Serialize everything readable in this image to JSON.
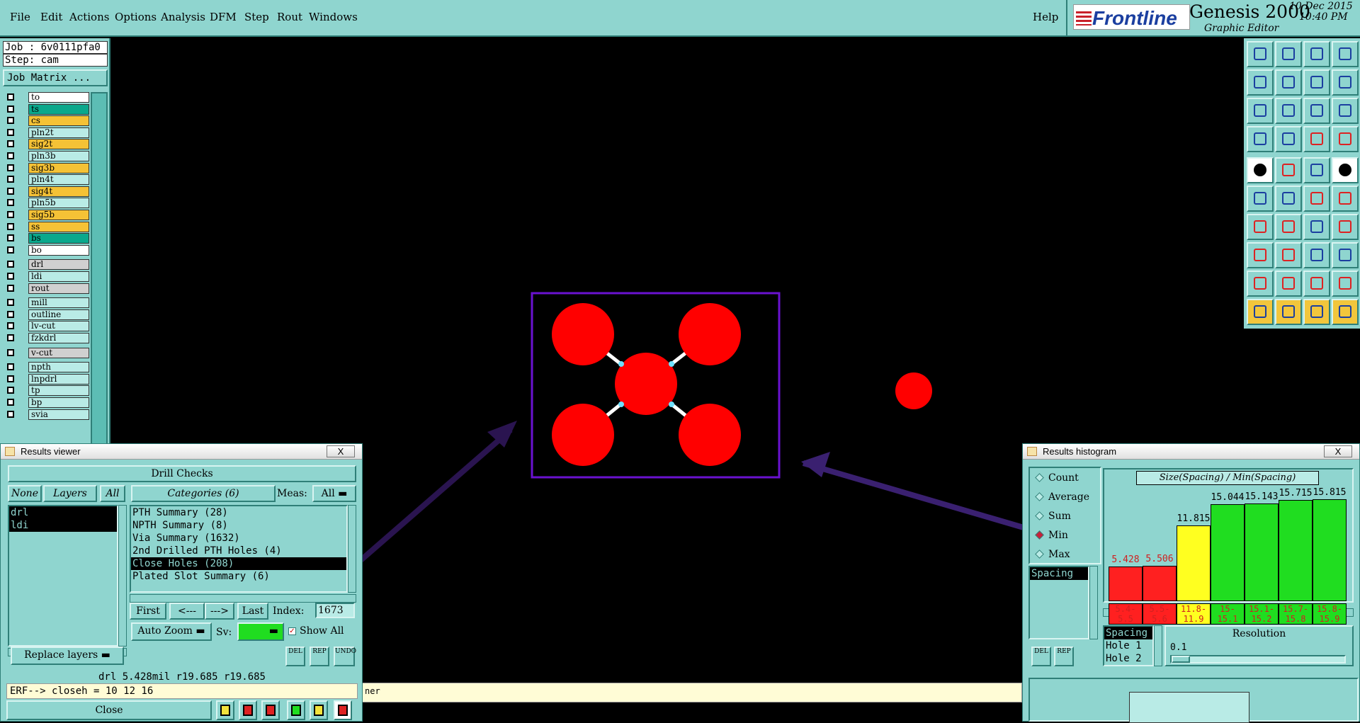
{
  "menu": {
    "items": [
      "File",
      "Edit",
      "Actions",
      "Options",
      "Analysis",
      "DFM",
      "Step",
      "Rout",
      "Windows"
    ],
    "help": "Help"
  },
  "brand": {
    "logo": "Frontline",
    "product": "Genesis 2000",
    "subtitle": "Graphic Editor",
    "date": "10 Dec 2015",
    "time": "10:40 PM"
  },
  "job": {
    "job_label": "Job : 6v0111pfa0",
    "step_label": "Step: cam",
    "matrix_button": "Job Matrix ..."
  },
  "layers": [
    {
      "name": "to",
      "color": "#ffffff"
    },
    {
      "name": "ts",
      "color": "#0aa88c"
    },
    {
      "name": "cs",
      "color": "#f5c236"
    },
    {
      "name": "pln2t",
      "color": "#b9ebe6"
    },
    {
      "name": "sig2t",
      "color": "#f5c236"
    },
    {
      "name": "pln3b",
      "color": "#b9ebe6"
    },
    {
      "name": "sig3b",
      "color": "#f5c236"
    },
    {
      "name": "pln4t",
      "color": "#b9ebe6"
    },
    {
      "name": "sig4t",
      "color": "#f5c236"
    },
    {
      "name": "pln5b",
      "color": "#b9ebe6"
    },
    {
      "name": "sig5b",
      "color": "#f5c236"
    },
    {
      "name": "ss",
      "color": "#f5c236"
    },
    {
      "name": "bs",
      "color": "#0aa88c"
    },
    {
      "name": "bo",
      "color": "#ffffff"
    },
    {
      "name": "drl",
      "color": "#d0d0d0"
    },
    {
      "name": "ldi",
      "color": "#b9ebe6"
    },
    {
      "name": "rout",
      "color": "#d0d0d0"
    },
    {
      "name": "mill",
      "color": "#b9ebe6"
    },
    {
      "name": "outline",
      "color": "#b9ebe6"
    },
    {
      "name": "lv-cut",
      "color": "#b9ebe6"
    },
    {
      "name": "fzkdrl",
      "color": "#b9ebe6"
    },
    {
      "name": "v-cut",
      "color": "#d0d0d0"
    },
    {
      "name": "npth",
      "color": "#b9ebe6"
    },
    {
      "name": "lnpdrl",
      "color": "#b9ebe6"
    },
    {
      "name": "tp",
      "color": "#b9ebe6"
    },
    {
      "name": "bp",
      "color": "#b9ebe6"
    },
    {
      "name": "svia",
      "color": "#b9ebe6"
    }
  ],
  "results_viewer": {
    "title": "Results viewer",
    "close_x": "X",
    "header": "Drill Checks",
    "filter_none": "None",
    "filter_layers": "Layers",
    "filter_all": "All",
    "layer_list": [
      "drl",
      "ldi"
    ],
    "categories_button": "Categories (6)",
    "meas_label": "Meas:",
    "meas_value": "All",
    "categories": [
      "PTH Summary (28)",
      "NPTH Summary (8)",
      "Via Summary (1632)",
      "2nd Drilled PTH Holes (4)",
      "Close Holes (208)",
      "Plated Slot Summary (6)"
    ],
    "selected_category": 4,
    "first": "First",
    "prev": "<---",
    "next": "--->",
    "last": "Last",
    "index_label": "Index:",
    "index_value": "1673",
    "auto_zoom": "Auto Zoom",
    "sv_label": "Sv:",
    "show_all": "Show All",
    "replace_layers": "Replace layers",
    "del": "DEL",
    "rep": "REP",
    "undo": "UNDO",
    "status": "drl 5.428mil  r19.685  r19.685",
    "erf": "ERF--> closeh = 10 12 16",
    "close": "Close"
  },
  "histogram": {
    "title": "Results histogram",
    "close_x": "X",
    "modes": [
      "Count",
      "Average",
      "Sum",
      "Min",
      "Max"
    ],
    "selected_mode": "Min",
    "measure_list": [
      "Spacing"
    ],
    "chart_title": "Size(Spacing) / Min(Spacing)",
    "del": "DEL",
    "rep": "REP",
    "params": [
      "Spacing",
      "Hole 1",
      "Hole 2"
    ],
    "resolution_label": "Resolution",
    "resolution_value": "0.1"
  },
  "chart_data": {
    "type": "bar",
    "title": "Size(Spacing) / Min(Spacing)",
    "categories": [
      "5.4-5.5",
      "5.5-5.6",
      "11.8-11.9",
      "15-15.1",
      "15.1-15.2",
      "15.7-15.8",
      "15.8-15.9"
    ],
    "category_labels_top": [
      "5.4-",
      "5.5-",
      "11.8-",
      "15-",
      "15.1-",
      "15.7-",
      "15.8-"
    ],
    "category_labels_bottom": [
      "5.5",
      "5.6",
      "11.9",
      "15.1",
      "15.2",
      "15.8",
      "15.9"
    ],
    "values": [
      5.428,
      5.506,
      11.815,
      15.044,
      15.143,
      15.715,
      15.815
    ],
    "value_labels": [
      "5.428",
      "5.506",
      "11.815",
      "15.044",
      "15.143",
      "15.715",
      "15.815"
    ],
    "bar_colors": [
      "#ff2020",
      "#ff2020",
      "#ffff20",
      "#20dd20",
      "#20dd20",
      "#20dd20",
      "#20dd20"
    ],
    "ylim": [
      0,
      16.5
    ]
  },
  "bottom_hint": "ner",
  "colors": {
    "panel": "#8fd5cf",
    "feature": "#ff0000",
    "highlight_box": "#6a12d0"
  }
}
